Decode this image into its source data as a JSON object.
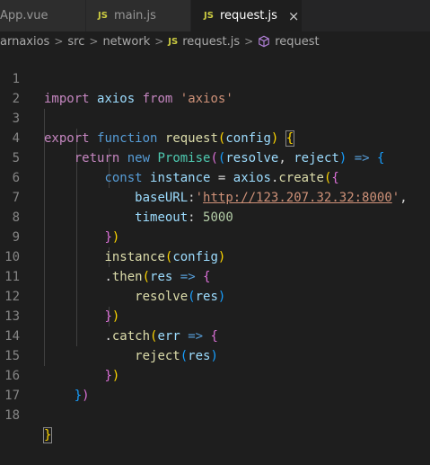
{
  "tabs": [
    {
      "label": "App.vue",
      "icon": "vue-file-icon",
      "active": false
    },
    {
      "label": "main.js",
      "icon": "js-file-icon",
      "badge": "JS",
      "active": false
    },
    {
      "label": "request.js",
      "icon": "js-file-icon",
      "badge": "JS",
      "active": true,
      "close": "×"
    }
  ],
  "breadcrumb": {
    "items": [
      "arnaxios",
      "src",
      "network",
      "request.js",
      "request"
    ],
    "separator": ">",
    "js_badge": "JS",
    "symbol_icon": "method-cube-icon"
  },
  "colors": {
    "editor_bg": "#1e1e1e",
    "tabbar_bg": "#252526",
    "keyword_control": "#c586c0",
    "keyword_declaration": "#569cd6",
    "variable": "#9cdcfe",
    "function": "#dcdcaa",
    "class": "#4ec9b0",
    "string": "#ce9178",
    "number": "#b5cea8"
  },
  "editor": {
    "line_numbers": [
      "1",
      "2",
      "3",
      "4",
      "5",
      "6",
      "7",
      "8",
      "9",
      "10",
      "11",
      "12",
      "13",
      "14",
      "15",
      "16",
      "17",
      "18"
    ],
    "tokens": {
      "import": "import",
      "axios": "axios",
      "from": "from",
      "axios_str": "'axios'",
      "export": "export",
      "function": "function",
      "request": "request",
      "config": "config",
      "return": "return",
      "new": "new",
      "Promise": "Promise",
      "resolve": "resolve",
      "reject": "reject",
      "arrow": "=>",
      "const": "const",
      "instance": "instance",
      "create": "create",
      "baseURL": "baseURL",
      "quote": "'",
      "url": "http://123.207.32.32:8000",
      "timeout": "timeout",
      "timeout_value": "5000",
      "then": "then",
      "res": "res",
      "catch": "catch",
      "err": "err"
    }
  }
}
